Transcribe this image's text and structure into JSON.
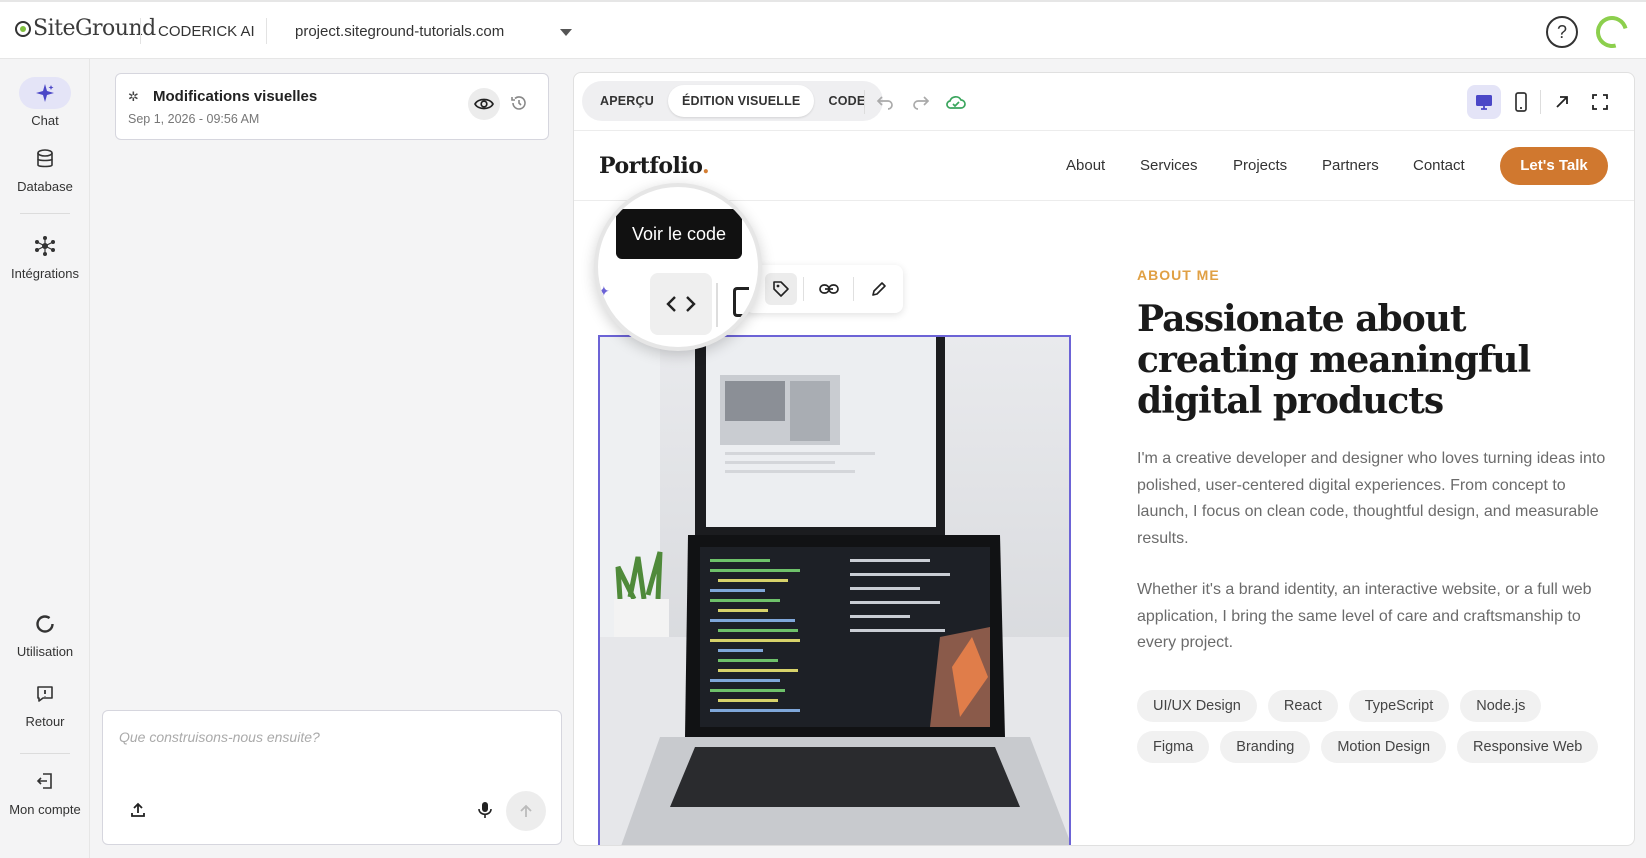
{
  "topbar": {
    "logo_text": "SiteGround",
    "brand": "CODERICK AI",
    "domain": "project.siteground-tutorials.com",
    "help_label": "?"
  },
  "leftnav": {
    "items": [
      {
        "label": "Chat",
        "icon": "sparkle-icon"
      },
      {
        "label": "Database",
        "icon": "database-icon"
      },
      {
        "label": "Intégrations",
        "icon": "integrations-icon"
      },
      {
        "label": "Utilisation",
        "icon": "usage-icon"
      },
      {
        "label": "Retour",
        "icon": "feedback-icon"
      },
      {
        "label": "Mon compte",
        "icon": "account-icon"
      }
    ]
  },
  "chat": {
    "card_title": "Modifications visuelles",
    "card_date": "Sep 1, 2026 - 09:56 AM",
    "composer_placeholder": "Que construisons-nous ensuite?"
  },
  "preview": {
    "modes": [
      "APERÇU",
      "ÉDITION VISUELLE",
      "CODE"
    ],
    "active_mode": "ÉDITION VISUELLE",
    "site": {
      "logo": "Portfolio",
      "logo_dot": ".",
      "nav": [
        "About",
        "Services",
        "Projects",
        "Partners",
        "Contact"
      ],
      "cta": "Let's Talk",
      "eyebrow": "ABOUT ME",
      "headline": "Passionate about creating meaningful digital products",
      "para1": "I'm a creative developer and designer who loves turning ideas into polished, user-centered digital experiences. From concept to launch, I focus on clean code, thoughtful design, and measurable results.",
      "para2": "Whether it's a brand identity, an interactive website, or a full web application, I bring the same level of care and craftsmanship to every project.",
      "tags": [
        "UI/UX Design",
        "React",
        "TypeScript",
        "Node.js",
        "Figma",
        "Branding",
        "Motion Design",
        "Responsive Web"
      ]
    },
    "tooltip": "Voir le code"
  },
  "colors": {
    "accent": "#6c63d6",
    "cta": "#d0782f",
    "eyebrow": "#e0a044",
    "brand_green": "#8ccf4d"
  }
}
